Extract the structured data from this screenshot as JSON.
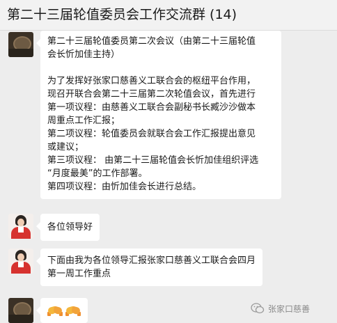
{
  "window": {
    "title": "第二十三届轮值委员会工作交流群 (14)"
  },
  "messages": [
    {
      "sender": "dark-avatar",
      "type": "text",
      "lines": [
        "第二十三届轮值委员第二次会议（由第二十三届轮值",
        "会长忻加佳主持）",
        "",
        "为了发挥好张家口慈善义工联合会的枢纽平台作用，",
        "现召开联合会第二十三届第二次轮值会议，首先进行",
        "第一项议程：由慈善义工联合会副秘书长臧沙沙做本",
        "周重点工作汇报；",
        "第二项议程：轮值委员会就联合会工作汇报提出意见",
        "或建议；",
        "第三项议程： 由第二十三届轮值会长忻加佳组织评选",
        "“月度最美”的工作部署。",
        "  第四项议程：由忻加佳会长进行总结。"
      ]
    },
    {
      "sender": "woman-avatar",
      "type": "text",
      "lines": [
        "各位领导好"
      ]
    },
    {
      "sender": "woman-avatar",
      "type": "text",
      "lines": [
        "下面由我为各位领导汇报张家口慈善义工联合会四月",
        "第一周工作重点"
      ]
    },
    {
      "sender": "dark-avatar",
      "type": "emoji",
      "emoji": [
        "handshake-icon",
        "handshake-icon"
      ]
    }
  ],
  "watermark": {
    "text": "张家口慈善"
  }
}
